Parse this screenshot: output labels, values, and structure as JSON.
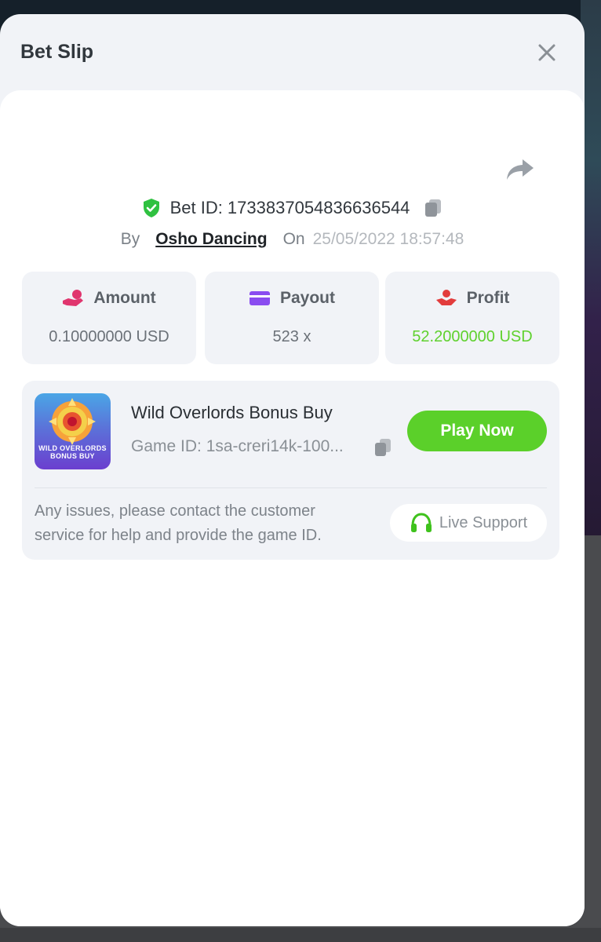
{
  "modal": {
    "title": "Bet Slip"
  },
  "bet": {
    "id_label": "Bet ID: 1733837054836636544",
    "by_label": "By",
    "user": "Osho Dancing",
    "on_label": "On",
    "date": "25/05/2022 18:57:48"
  },
  "stats": [
    {
      "label": "Amount",
      "value": "0.10000000 USD",
      "icon": "coins-hand-icon"
    },
    {
      "label": "Payout",
      "value": "523 x",
      "icon": "card-icon"
    },
    {
      "label": "Profit",
      "value": "52.2000000 USD",
      "icon": "profit-hand-icon"
    }
  ],
  "game": {
    "name": "Wild Overlords Bonus Buy",
    "id_label": "Game ID: 1sa-creri14k-100...",
    "thumb_text_1": "WILD OVERLORDS",
    "thumb_text_2": "BONUS BUY",
    "play_label": "Play Now",
    "help_text": "Any issues, please contact the customer service for help and provide the game ID.",
    "support_label": "Live Support"
  },
  "colors": {
    "accent_green": "#5bd02a",
    "profit_green": "#5fd12e",
    "shield_green": "#2fc140",
    "amount_icon": "#e0356e",
    "payout_icon": "#8a4cf0",
    "profit_icon": "#e23c3c"
  }
}
